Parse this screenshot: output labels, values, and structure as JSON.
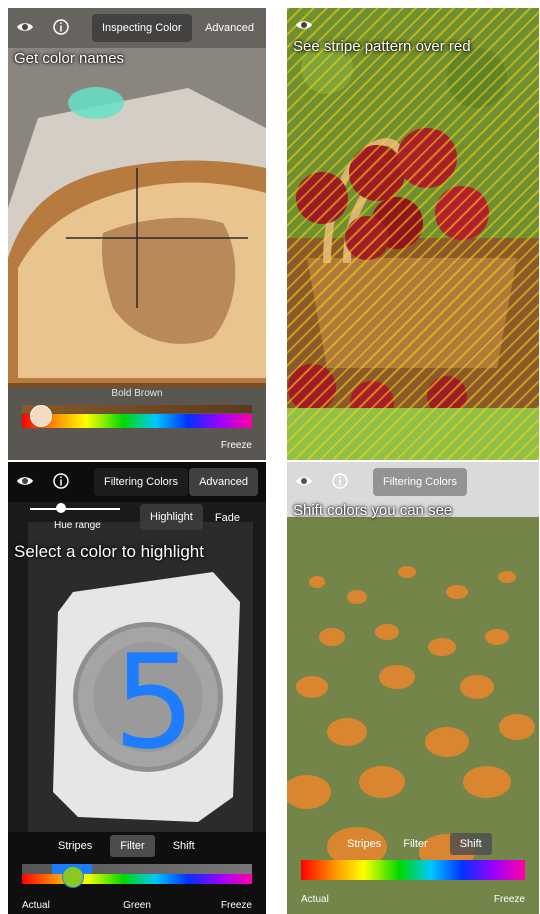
{
  "panels": {
    "color_names": {
      "mode_label": "Inspecting Color",
      "advanced_label": "Advanced",
      "headline": "Get color names",
      "color_name": "Bold Brown",
      "freeze_label": "Freeze",
      "hue_slider_level": 0.08
    },
    "stripe": {
      "headline": "See stripe pattern over red"
    },
    "filter": {
      "mode_label": "Filtering Colors",
      "advanced_label": "Advanced",
      "hue_range_label": "Hue range",
      "highlight_label": "Highlight",
      "fade_label": "Fade",
      "headline": "Select a color to highlight",
      "plate_digit": "5",
      "tabs": [
        "Stripes",
        "Filter",
        "Shift"
      ],
      "active_tab": "Filter",
      "bottom_left": "Actual",
      "bottom_center": "Green",
      "bottom_right": "Freeze",
      "hue_slider_level": 0.21
    },
    "shift": {
      "mode_label": "Filtering Colors",
      "headline": "Shift colors you can see",
      "tabs": [
        "Stripes",
        "Filter",
        "Shift"
      ],
      "active_tab": "Shift",
      "bottom_left": "Actual",
      "bottom_right": "Freeze"
    }
  },
  "colors": {
    "accent_green": "#8ac924",
    "brown": "#6b4628",
    "blue_highlight": "#1e7dff"
  },
  "icons": [
    "eye-icon",
    "info-icon"
  ]
}
